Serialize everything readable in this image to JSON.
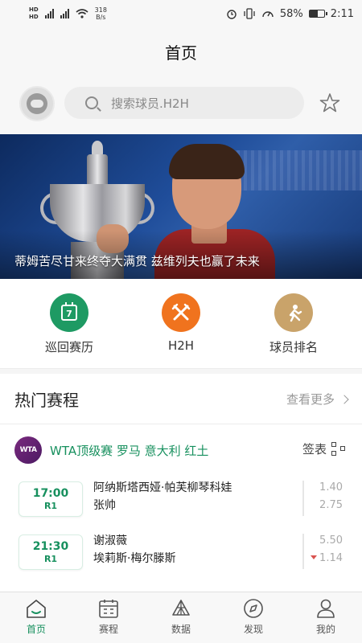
{
  "status_bar": {
    "net_speed": "318",
    "net_unit": "B/s",
    "battery": "58%",
    "battery_level": 0.58,
    "time": "2:11"
  },
  "header": {
    "title": "首页"
  },
  "search": {
    "placeholder": "搜索球员.H2H"
  },
  "banner": {
    "caption": "蒂姆苦尽甘来终夺大满贯 兹维列夫也赢了未来"
  },
  "quick_nav": [
    {
      "label": "巡回赛历",
      "icon": "calendar-icon",
      "color": "#1e9a63"
    },
    {
      "label": "H2H",
      "icon": "crossed-rackets-icon",
      "color": "#f0731e"
    },
    {
      "label": "球员排名",
      "icon": "player-ranking-icon",
      "color": "#c9a36a"
    }
  ],
  "hot_schedule": {
    "title": "热门赛程",
    "more": "查看更多",
    "tournament": {
      "logo": "WTA",
      "name": "WTA顶级赛 罗马 意大利 红土",
      "draw_label": "签表"
    },
    "matches": [
      {
        "time": "17:00",
        "round": "R1",
        "player1": "阿纳斯塔西娅·帕芙柳琴科娃",
        "player2": "张帅",
        "odds1": "1.40",
        "odds2": "2.75",
        "odds2_down": false
      },
      {
        "time": "21:30",
        "round": "R1",
        "player1": "谢淑薇",
        "player2": "埃莉斯·梅尔滕斯",
        "odds1": "5.50",
        "odds2": "1.14",
        "odds2_down": true
      }
    ]
  },
  "tab_bar": [
    {
      "label": "首页",
      "icon": "home-icon",
      "active": true
    },
    {
      "label": "赛程",
      "icon": "schedule-icon",
      "active": false
    },
    {
      "label": "数据",
      "icon": "data-icon",
      "active": false
    },
    {
      "label": "发现",
      "icon": "compass-icon",
      "active": false
    },
    {
      "label": "我的",
      "icon": "profile-icon",
      "active": false
    }
  ],
  "colors": {
    "accent": "#17905e",
    "down": "#d9534f"
  }
}
